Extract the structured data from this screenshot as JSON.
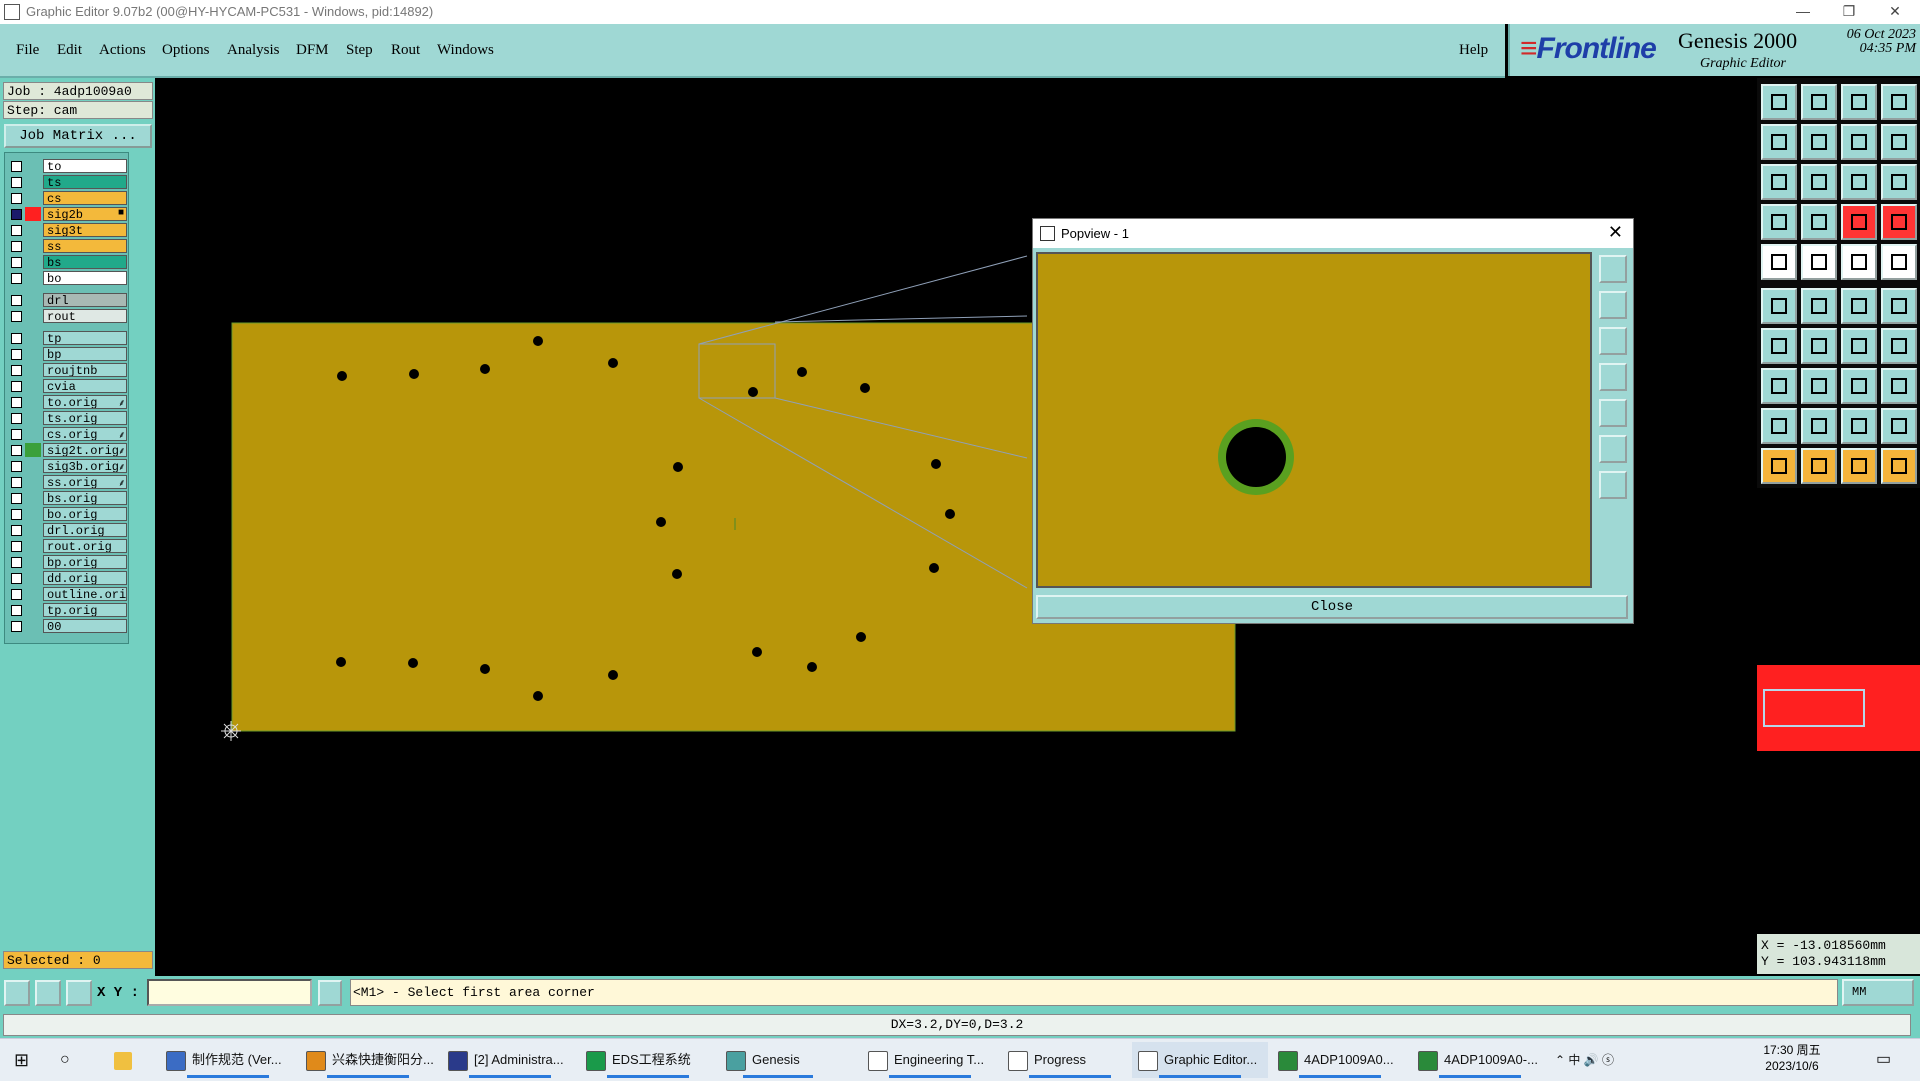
{
  "window": {
    "title": "Graphic Editor 9.07b2 (00@HY-HYCAM-PC531 - Windows, pid:14892)",
    "controls": {
      "minimize": "—",
      "restore": "❐",
      "close": "✕"
    }
  },
  "menu": [
    "File",
    "Edit",
    "Actions",
    "Options",
    "Analysis",
    "DFM",
    "Step",
    "Rout",
    "Windows"
  ],
  "help": "Help",
  "branding": {
    "logo": "Frontline",
    "product": "Genesis 2000",
    "subtitle": "Graphic Editor",
    "date": "06 Oct 2023",
    "time": "04:35 PM"
  },
  "job": {
    "job_line": "Job : 4adp1009a0",
    "step_line": "Step: cam",
    "matrix_button": "Job Matrix ..."
  },
  "layers": [
    {
      "name": "to",
      "color": "#ffffff",
      "checked": false
    },
    {
      "name": "ts",
      "color": "#21a98a",
      "checked": false
    },
    {
      "name": "cs",
      "color": "#f3b93b",
      "checked": false
    },
    {
      "name": "sig2b",
      "color": "#f3b93b",
      "checked": true,
      "marker": "■",
      "work": true
    },
    {
      "name": "sig3t",
      "color": "#f3b93b",
      "checked": false
    },
    {
      "name": "ss",
      "color": "#f3b93b",
      "checked": false
    },
    {
      "name": "bs",
      "color": "#21a98a",
      "checked": false
    },
    {
      "name": "bo",
      "color": "#ffffff",
      "checked": false
    },
    {
      "name": "drl",
      "color": "#a8b9b4",
      "checked": false,
      "gap": true
    },
    {
      "name": "rout",
      "color": "#dfe8e4",
      "checked": false
    },
    {
      "name": "tp",
      "color": "#9fd8d4",
      "checked": false,
      "gap": true
    },
    {
      "name": "bp",
      "color": "#9fd8d4",
      "checked": false
    },
    {
      "name": "roujtnb",
      "color": "#9fd8d4",
      "checked": false
    },
    {
      "name": "cvia",
      "color": "#9fd8d4",
      "checked": false
    },
    {
      "name": "to.orig",
      "color": "#9fd8d4",
      "checked": false,
      "marker": "⸙"
    },
    {
      "name": "ts.orig",
      "color": "#9fd8d4",
      "checked": false
    },
    {
      "name": "cs.orig",
      "color": "#9fd8d4",
      "checked": false,
      "marker": "⸙"
    },
    {
      "name": "sig2t.orig",
      "color": "#9fd8d4",
      "checked": false,
      "marker": "⸙",
      "green": true
    },
    {
      "name": "sig3b.orig",
      "color": "#9fd8d4",
      "checked": false,
      "marker": "⸙"
    },
    {
      "name": "ss.orig",
      "color": "#9fd8d4",
      "checked": false,
      "marker": "⸙"
    },
    {
      "name": "bs.orig",
      "color": "#9fd8d4",
      "checked": false
    },
    {
      "name": "bo.orig",
      "color": "#9fd8d4",
      "checked": false
    },
    {
      "name": "drl.orig",
      "color": "#9fd8d4",
      "checked": false
    },
    {
      "name": "rout.orig",
      "color": "#9fd8d4",
      "checked": false
    },
    {
      "name": "bp.orig",
      "color": "#9fd8d4",
      "checked": false
    },
    {
      "name": "dd.orig",
      "color": "#9fd8d4",
      "checked": false
    },
    {
      "name": "outline.orig",
      "color": "#9fd8d4",
      "checked": false
    },
    {
      "name": "tp.orig",
      "color": "#9fd8d4",
      "checked": false
    },
    {
      "name": "00",
      "color": "#9fd8d4",
      "checked": false
    }
  ],
  "selected": "Selected : 0",
  "popview": {
    "title": "Popview - 1",
    "close_label": "Close",
    "close_x": "✕"
  },
  "coords": {
    "x": "X = -13.018560mm",
    "y": "Y = 103.943118mm"
  },
  "command": {
    "xy_label": "X Y :",
    "xy_value": "",
    "message": "<M1> - Select first area corner",
    "units": "MM"
  },
  "status": "DX=3.2,DY=0,D=3.2",
  "taskbar": {
    "items": [
      {
        "label": "制作规范 (Ver...",
        "color": "#3b6cc4"
      },
      {
        "label": "兴森快捷衡阳分...",
        "color": "#e08a1a"
      },
      {
        "label": "[2] Administra...",
        "color": "#2a3a8a"
      },
      {
        "label": "EDS工程系统",
        "color": "#1a9a4a"
      },
      {
        "label": "Genesis",
        "color": "#4aa0a0"
      },
      {
        "label": "Engineering T...",
        "color": "#ffffff"
      },
      {
        "label": "Progress",
        "color": "#ffffff"
      },
      {
        "label": "Graphic Editor...",
        "color": "#ffffff"
      },
      {
        "label": "4ADP1009A0...",
        "color": "#2a8a3a"
      },
      {
        "label": "4ADP1009A0-...",
        "color": "#2a8a3a"
      }
    ],
    "tray": "⌃ 中 🔊 ⓢ",
    "clock_time": "17:30 周五",
    "clock_date": "2023/10/6",
    "ime": "中"
  },
  "colors": {
    "board": "#b8960a",
    "panel": "#73d0c1",
    "menubar": "#9fd8d4",
    "accent_red": "#ff2020",
    "pad_ring": "#5aa020"
  }
}
